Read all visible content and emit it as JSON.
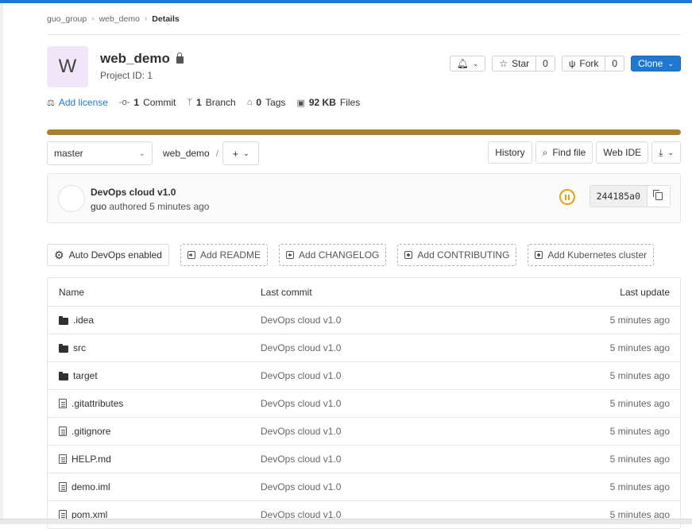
{
  "breadcrumb": {
    "group": "guo_group",
    "project": "web_demo",
    "current": "Details"
  },
  "project": {
    "avatar_letter": "W",
    "name": "web_demo",
    "id_text": "Project ID: 1"
  },
  "actions": {
    "star_label": "Star",
    "star_count": "0",
    "fork_label": "Fork",
    "fork_count": "0",
    "clone_label": "Clone"
  },
  "stats": {
    "license": "Add license",
    "commits_num": "1",
    "commits_label": "Commit",
    "branches_num": "1",
    "branches_label": "Branch",
    "tags_num": "0",
    "tags_label": "Tags",
    "files_size": "92 KB",
    "files_label": "Files"
  },
  "tree": {
    "branch": "master",
    "path": "web_demo",
    "path_sep": "/",
    "history": "History",
    "find_file": "Find file",
    "web_ide": "Web IDE"
  },
  "commit": {
    "title": "DevOps cloud v1.0",
    "author": "guo",
    "meta": "authored 5 minutes ago",
    "sha": "244185a0"
  },
  "quick_actions": {
    "auto_devops": "Auto DevOps enabled",
    "readme": "Add README",
    "changelog": "Add CHANGELOG",
    "contributing": "Add CONTRIBUTING",
    "k8s": "Add Kubernetes cluster"
  },
  "table": {
    "headers": {
      "name": "Name",
      "last_commit": "Last commit",
      "last_update": "Last update"
    },
    "rows": [
      {
        "name": ".idea",
        "type": "folder",
        "commit": "DevOps cloud v1.0",
        "updated": "5 minutes ago"
      },
      {
        "name": "src",
        "type": "folder",
        "commit": "DevOps cloud v1.0",
        "updated": "5 minutes ago"
      },
      {
        "name": "target",
        "type": "folder",
        "commit": "DevOps cloud v1.0",
        "updated": "5 minutes ago"
      },
      {
        "name": ".gitattributes",
        "type": "file",
        "commit": "DevOps cloud v1.0",
        "updated": "5 minutes ago"
      },
      {
        "name": ".gitignore",
        "type": "file",
        "commit": "DevOps cloud v1.0",
        "updated": "5 minutes ago"
      },
      {
        "name": "HELP.md",
        "type": "file",
        "commit": "DevOps cloud v1.0",
        "updated": "5 minutes ago"
      },
      {
        "name": "demo.iml",
        "type": "file",
        "commit": "DevOps cloud v1.0",
        "updated": "5 minutes ago"
      },
      {
        "name": "pom.xml",
        "type": "file",
        "commit": "DevOps cloud v1.0",
        "updated": "5 minutes ago"
      }
    ]
  },
  "colors": {
    "primary": "#1f78d1",
    "progress": "#a8802f",
    "pipeline_running": "#e5a016",
    "avatar_bg": "#f1e6f7"
  }
}
